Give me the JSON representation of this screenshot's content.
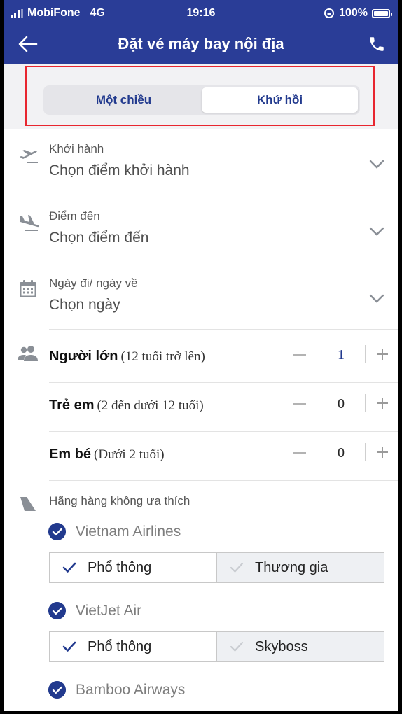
{
  "status_bar": {
    "carrier": "MobiFone",
    "network": "4G",
    "time": "19:16",
    "battery": "100%"
  },
  "header": {
    "title": "Đặt vé máy bay nội địa"
  },
  "trip_type": {
    "options": [
      "Một chiều",
      "Khứ hồi"
    ],
    "selected": "Khứ hồi"
  },
  "fields": {
    "departure": {
      "label": "Khởi hành",
      "value": "Chọn điểm khởi hành"
    },
    "destination": {
      "label": "Điểm đến",
      "value": "Chọn điểm đến"
    },
    "dates": {
      "label": "Ngày đi/ ngày về",
      "value": "Chọn ngày"
    }
  },
  "passengers": {
    "adult": {
      "name": "Người lớn",
      "note": "(12 tuổi trở lên)",
      "count": "1"
    },
    "child": {
      "name": "Trẻ em",
      "note": "(2 đến dưới 12 tuổi)",
      "count": "0"
    },
    "infant": {
      "name": "Em bé",
      "note": "(Dưới 2 tuổi)",
      "count": "0"
    }
  },
  "airlines": {
    "label": "Hãng hàng không ưa thích",
    "items": [
      {
        "name": "Vietnam Airlines",
        "checked": true,
        "classes": [
          "Phổ thông",
          "Thương gia"
        ]
      },
      {
        "name": "VietJet Air",
        "checked": true,
        "classes": [
          "Phổ thông",
          "Skyboss"
        ]
      },
      {
        "name": "Bamboo Airways",
        "checked": true
      }
    ]
  },
  "colors": {
    "primary": "#2a3d97",
    "highlight": "#e8262f",
    "icon_grey": "#8a8f96"
  }
}
